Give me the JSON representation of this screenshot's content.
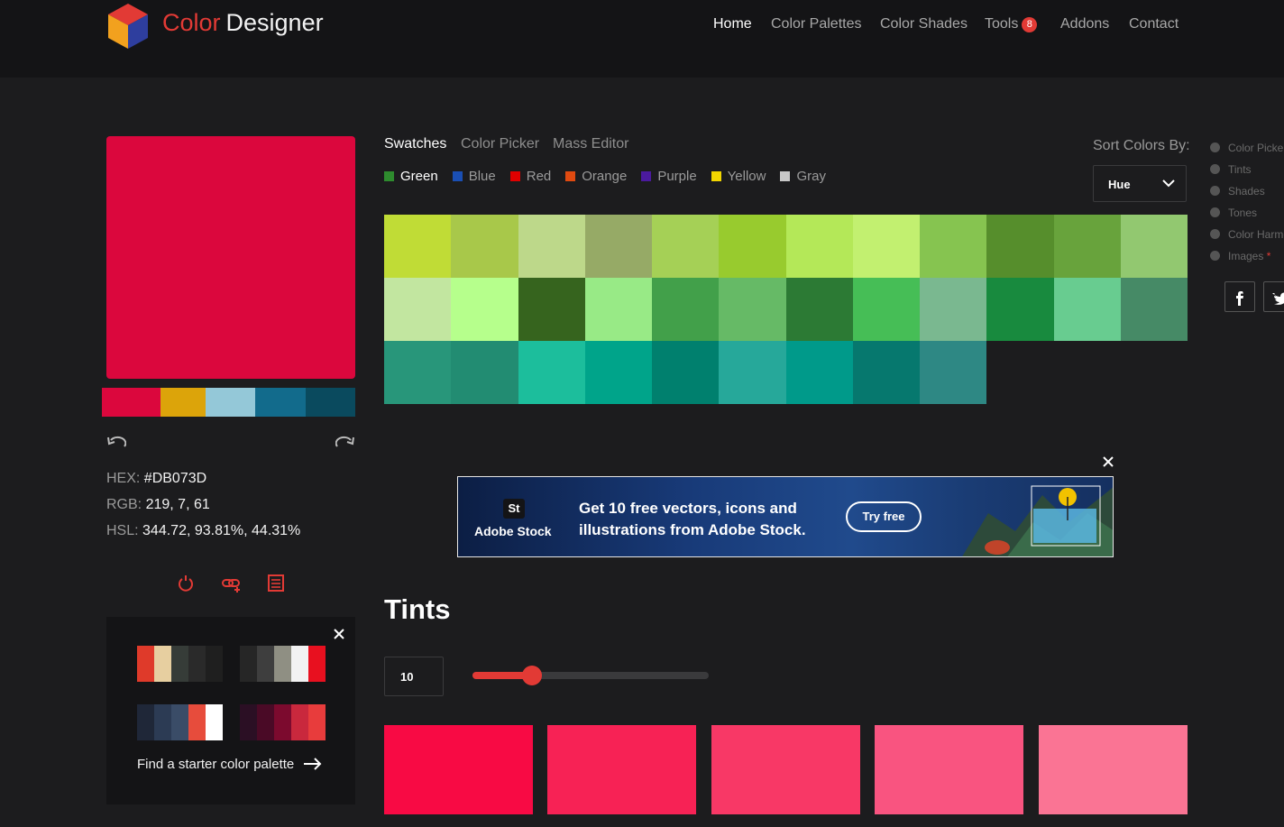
{
  "header": {
    "brand_part1": "Color",
    "brand_part2": "Designer",
    "nav": [
      {
        "label": "Home",
        "active": true
      },
      {
        "label": "Color Palettes"
      },
      {
        "label": "Color Shades"
      },
      {
        "label": "Tools",
        "badge": "8"
      },
      {
        "label": "Addons"
      },
      {
        "label": "Contact"
      }
    ]
  },
  "current_color": {
    "swatch": "#DB073D",
    "palette": [
      "#DB073D",
      "#DCA40A",
      "#94C8D8",
      "#126B8C",
      "#0A4A5E"
    ],
    "hex_label": "HEX:",
    "hex_value": "#DB073D",
    "rgb_label": "RGB:",
    "rgb_value": "219, 7, 61",
    "hsl_label": "HSL:",
    "hsl_value": "344.72, 93.81%, 44.31%",
    "actions": [
      "reset-icon",
      "link-add-icon",
      "list-icon"
    ]
  },
  "starter": {
    "palettes": [
      [
        "#DF3A2A",
        "#E7CFA0",
        "#363C38",
        "#2A2A2A",
        "#1F1F1F"
      ],
      [
        "#262626",
        "#3E3E3E",
        "#8F8F83",
        "#F2F2F2",
        "#E8101F"
      ],
      [
        "#1F2738",
        "#2C3B54",
        "#3A4C67",
        "#E74C3C",
        "#FFFFFF"
      ],
      [
        "#2B0F24",
        "#4A0A26",
        "#7C0A2E",
        "#C9283D",
        "#E83C3C"
      ]
    ],
    "link_label": "Find a starter color palette"
  },
  "tabs": [
    {
      "label": "Swatches",
      "active": true
    },
    {
      "label": "Color Picker"
    },
    {
      "label": "Mass Editor"
    }
  ],
  "filters": [
    {
      "label": "Green",
      "color": "#2E8B2E",
      "active": true
    },
    {
      "label": "Blue",
      "color": "#1A4FB4"
    },
    {
      "label": "Red",
      "color": "#E00000"
    },
    {
      "label": "Orange",
      "color": "#E04A10"
    },
    {
      "label": "Purple",
      "color": "#4B1A9E"
    },
    {
      "label": "Yellow",
      "color": "#F2D600"
    },
    {
      "label": "Gray",
      "color": "#C8C8C8"
    }
  ],
  "sort": {
    "label": "Sort Colors By:",
    "value": "Hue"
  },
  "swatches": [
    "#C0DC36",
    "#A8C84A",
    "#BDD88A",
    "#96AA66",
    "#A5D056",
    "#98CB2E",
    "#B4E858",
    "#C2F070",
    "#86C450",
    "#568E2C",
    "#68A33C",
    "#92C870",
    "#C2E6A0",
    "#B6FF8C",
    "#36641E",
    "#98EA86",
    "#42A04A",
    "#66BA66",
    "#2C7A34",
    "#46BE56",
    "#7AB890",
    "#188A3E",
    "#68CC90",
    "#468A66",
    "#28967A",
    "#228C72",
    "#1CBE9C",
    "#00A48A",
    "#00806E",
    "#26A89A",
    "#009A8A",
    "#06786E",
    "#2E8884"
  ],
  "sidebar": [
    {
      "label": "Color Picker"
    },
    {
      "label": "Tints"
    },
    {
      "label": "Shades"
    },
    {
      "label": "Tones"
    },
    {
      "label": "Color Harmonies"
    },
    {
      "label": "Images",
      "star": "*"
    }
  ],
  "ad": {
    "logo_text": "St",
    "brand": "Adobe Stock",
    "line1": "Get 10 free vectors, icons and",
    "line2": "illustrations from Adobe Stock.",
    "button": "Try free"
  },
  "tints": {
    "title": "Tints",
    "count": "10",
    "slider_fraction": 0.25,
    "colors": [
      "#F80A44",
      "#F72255",
      "#F83866",
      "#F95480",
      "#FA7494"
    ]
  }
}
